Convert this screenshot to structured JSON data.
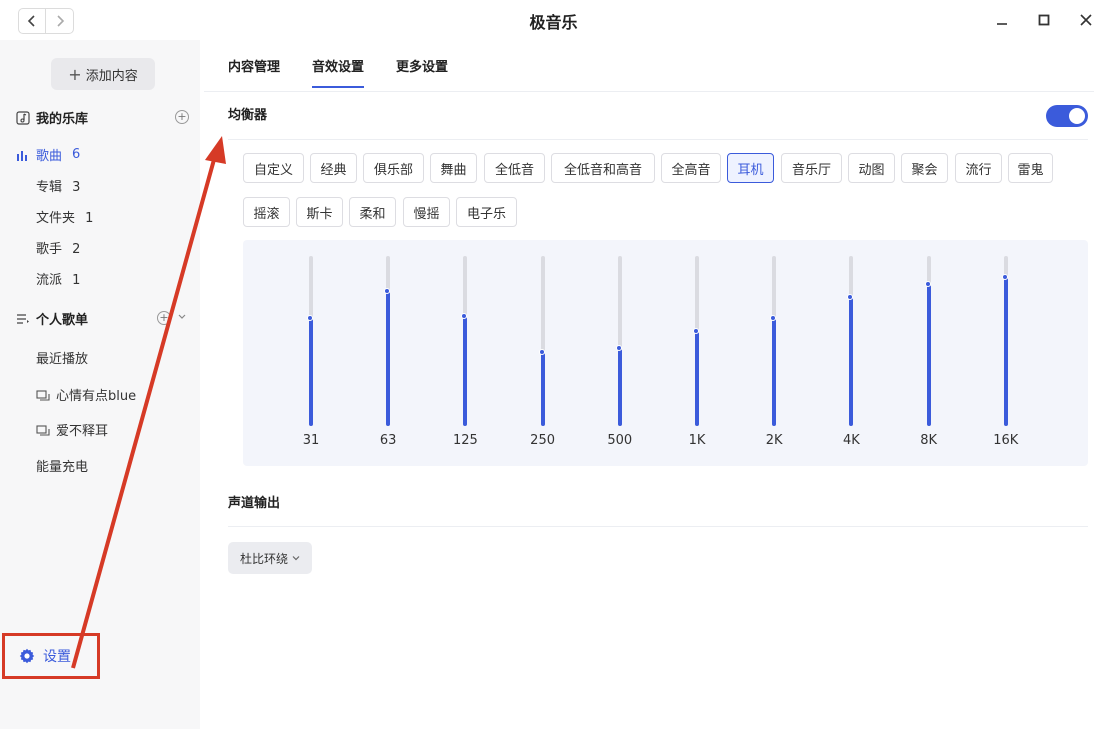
{
  "window": {
    "title": "极音乐",
    "back_icon": "chevron-left-icon",
    "forward_icon": "chevron-right-icon",
    "minimize_glyph": "—",
    "maximize_glyph": "□",
    "close_glyph": "✕"
  },
  "sidebar": {
    "add_button": "添加内容",
    "library": {
      "title": "我的乐库",
      "items": [
        {
          "label": "歌曲",
          "count": "6"
        },
        {
          "label": "专辑",
          "count": "3"
        },
        {
          "label": "文件夹",
          "count": "1"
        },
        {
          "label": "歌手",
          "count": "2"
        },
        {
          "label": "流派",
          "count": "1"
        }
      ]
    },
    "playlists": {
      "title": "个人歌单",
      "items": [
        "最近播放",
        "心情有点blue",
        "爱不释耳",
        "能量充电"
      ]
    },
    "settings_label": "设置"
  },
  "tabs": [
    "内容管理",
    "音效设置",
    "更多设置"
  ],
  "active_tab": "音效设置",
  "equalizer": {
    "title": "均衡器",
    "enabled": true,
    "presets": [
      "自定义",
      "经典",
      "俱乐部",
      "舞曲",
      "全低音",
      "全低音和高音",
      "全高音",
      "耳机",
      "音乐厅",
      "动图",
      "聚会",
      "流行",
      "雷鬼",
      "摇滚",
      "斯卡",
      "柔和",
      "慢摇",
      "电子乐"
    ],
    "active_preset": "耳机",
    "bands": [
      {
        "freq": "31",
        "level": 0.63
      },
      {
        "freq": "63",
        "level": 0.79
      },
      {
        "freq": "125",
        "level": 0.64
      },
      {
        "freq": "250",
        "level": 0.43
      },
      {
        "freq": "500",
        "level": 0.45
      },
      {
        "freq": "1K",
        "level": 0.55
      },
      {
        "freq": "2K",
        "level": 0.63
      },
      {
        "freq": "4K",
        "level": 0.75
      },
      {
        "freq": "8K",
        "level": 0.83
      },
      {
        "freq": "16K",
        "level": 0.87
      }
    ]
  },
  "channel_output": {
    "title": "声道输出",
    "selected": "杜比环绕"
  },
  "colors": {
    "accent": "#3b5bdb",
    "annotation": "#d63a26"
  }
}
